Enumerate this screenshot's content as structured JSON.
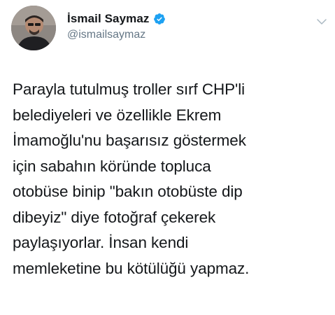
{
  "author": {
    "display_name": "İsmail Saymaz",
    "handle": "@ismailsaymaz",
    "verified": true,
    "verified_icon": "verified-badge-icon"
  },
  "menu_icon": "chevron-down-icon",
  "avatar_icon": "profile-photo",
  "tweet": {
    "text": "Parayla tutulmuş troller sırf CHP'li\nbelediyeleri ve özellikle Ekrem\nİmamoğlu'nu başarısız göstermek\niçin sabahın köründe topluca\notobüse binip \"bakın otobüste dip\ndibeyiz\" diye fotoğraf çekerek\npaylaşıyorlar. İnsan kendi\nmemleketine bu kötülüğü yapmaz."
  },
  "colors": {
    "text": "#14171a",
    "secondary": "#657786",
    "verified": "#1da1f2"
  }
}
